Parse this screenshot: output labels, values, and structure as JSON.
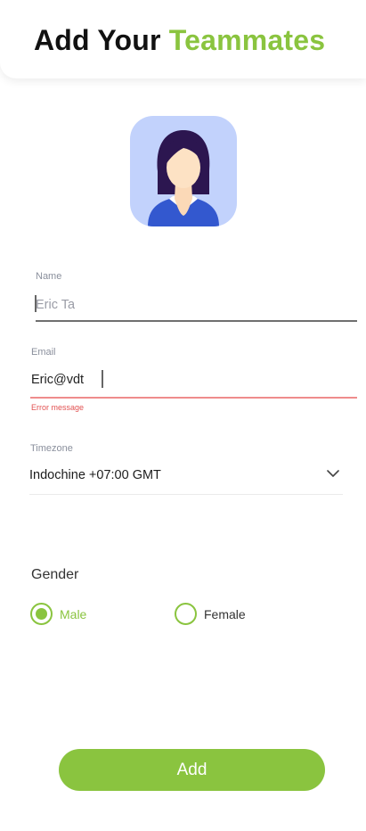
{
  "header": {
    "title_part1": "Add Your",
    "title_part2": "Teammates"
  },
  "avatar": {
    "icon": "person-avatar-icon"
  },
  "form": {
    "name": {
      "label": "Name",
      "placeholder": "Eric Ta"
    },
    "email": {
      "label": "Email",
      "value": "Eric@vdt",
      "error": "Error message"
    },
    "timezone": {
      "label": "Timezone",
      "value": "Indochine +07:00 GMT"
    },
    "gender": {
      "label": "Gender",
      "options": [
        {
          "label": "Male",
          "selected": true
        },
        {
          "label": "Female",
          "selected": false
        }
      ]
    }
  },
  "actions": {
    "add_label": "Add"
  },
  "colors": {
    "accent": "#8ac43f",
    "error": "#e25252",
    "avatar_bg": "#c2d2fc"
  }
}
